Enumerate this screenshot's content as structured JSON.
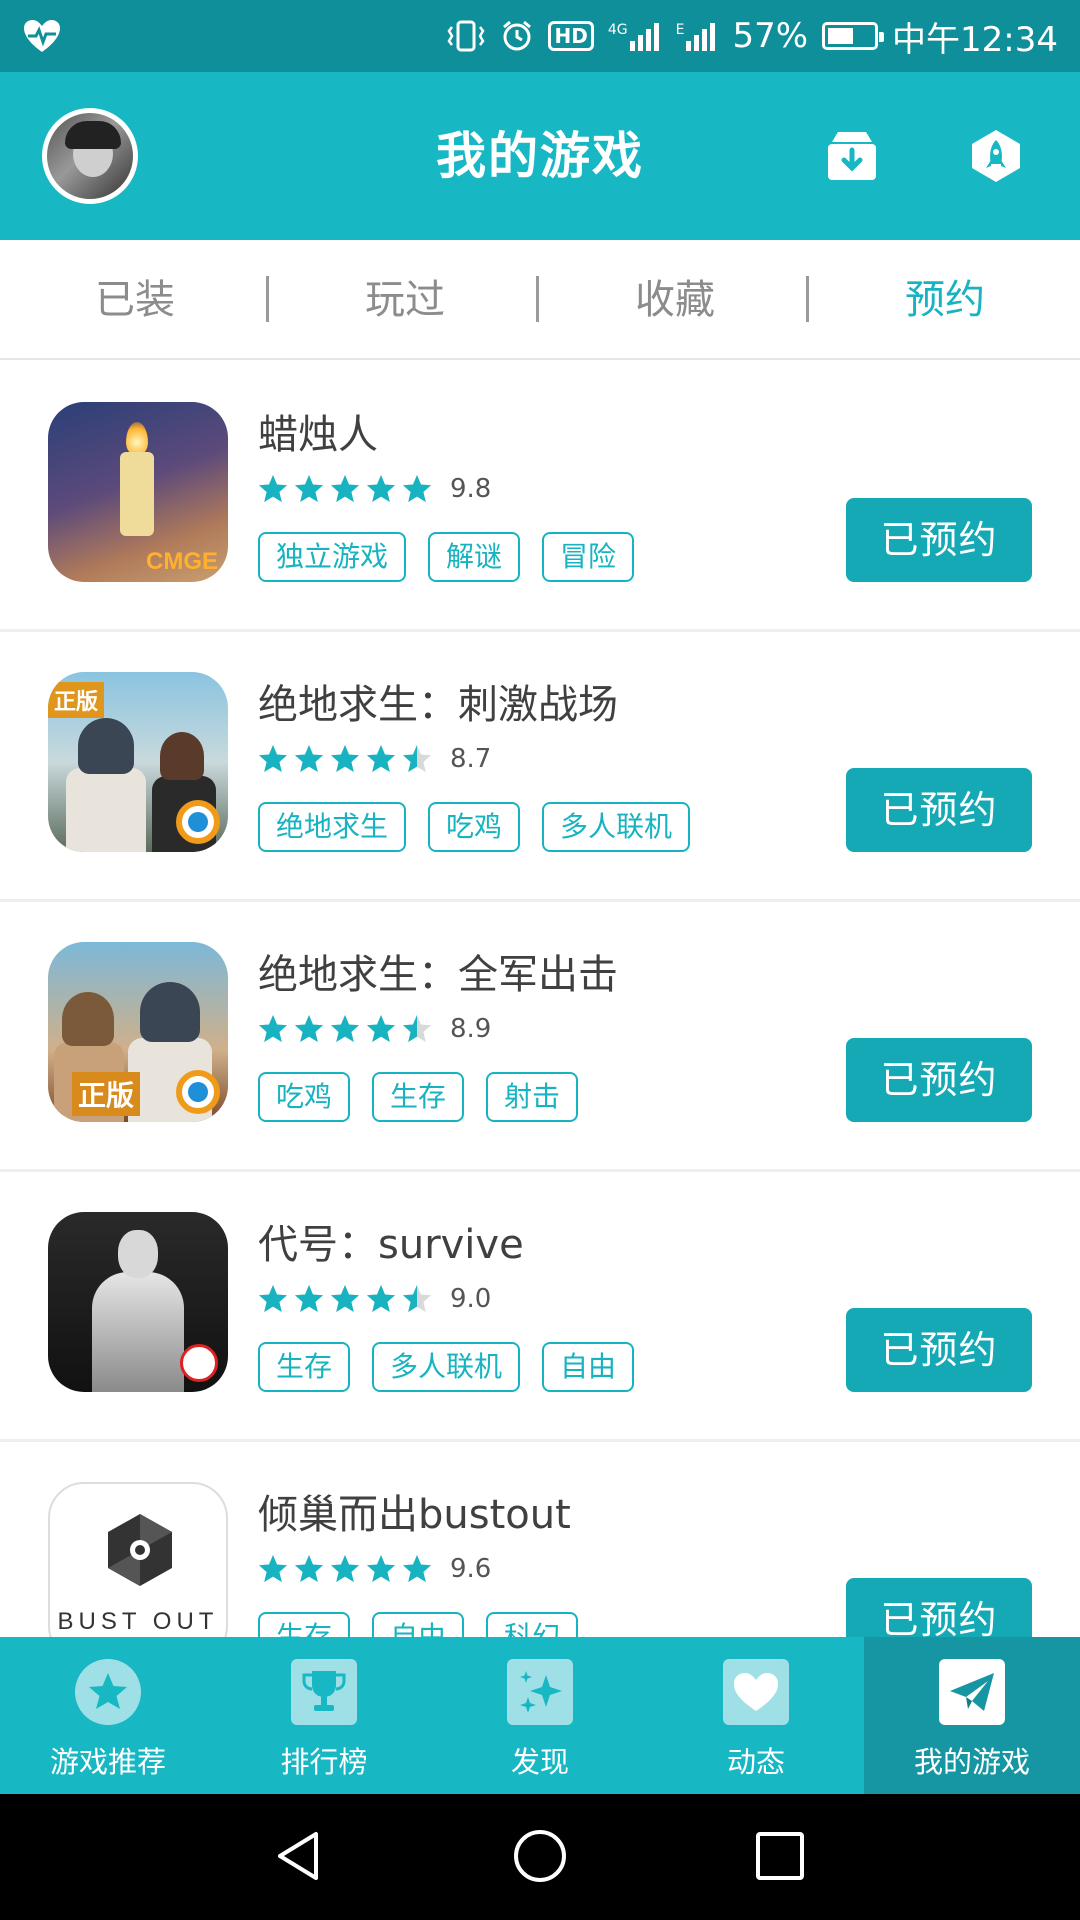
{
  "status_bar": {
    "network_badge": "HD",
    "network_type_1": "4G",
    "network_type_2": "E",
    "battery_percent": "57%",
    "battery_level": 0.57,
    "time": "中午12:34"
  },
  "header": {
    "title": "我的游戏",
    "icons": [
      "avatar",
      "download-box-icon",
      "rocket-icon"
    ]
  },
  "tabs": [
    {
      "label": "已装",
      "active": false
    },
    {
      "label": "玩过",
      "active": false
    },
    {
      "label": "收藏",
      "active": false
    },
    {
      "label": "预约",
      "active": true
    }
  ],
  "games": [
    {
      "name": "蜡烛人",
      "rating": 9.8,
      "score": "9.8",
      "stars": 5,
      "tags": [
        "独立游戏",
        "解谜",
        "冒险"
      ],
      "button": "已预约",
      "icon_text": "CMGE"
    },
    {
      "name": "绝地求生：刺激战场",
      "rating": 8.7,
      "score": "8.7",
      "stars": 4.5,
      "tags": [
        "绝地求生",
        "吃鸡",
        "多人联机"
      ],
      "button": "已预约",
      "icon_text": "正版"
    },
    {
      "name": "绝地求生：全军出击",
      "rating": 8.9,
      "score": "8.9",
      "stars": 4.5,
      "tags": [
        "吃鸡",
        "生存",
        "射击"
      ],
      "button": "已预约",
      "icon_text": "正版"
    },
    {
      "name": "代号：survive",
      "rating": 9.0,
      "score": "9.0",
      "stars": 4.5,
      "tags": [
        "生存",
        "多人联机",
        "自由"
      ],
      "button": "已预约"
    },
    {
      "name": "倾巢而出bustout",
      "rating": 9.6,
      "score": "9.6",
      "stars": 5,
      "tags": [
        "生存",
        "自由",
        "科幻"
      ],
      "button": "已预约",
      "icon_text": "BUST OUT"
    }
  ],
  "bottom_nav": [
    {
      "label": "游戏推荐",
      "icon": "star-icon",
      "active": false
    },
    {
      "label": "排行榜",
      "icon": "trophy-icon",
      "active": false
    },
    {
      "label": "发现",
      "icon": "sparkle-icon",
      "active": false
    },
    {
      "label": "动态",
      "icon": "heart-icon",
      "active": false
    },
    {
      "label": "我的游戏",
      "icon": "paper-plane-icon",
      "active": true
    }
  ],
  "colors": {
    "accent": "#17b7c4",
    "status_bar": "#0f8f9a",
    "button": "#15a9b6",
    "nav_active": "#1596a2"
  }
}
